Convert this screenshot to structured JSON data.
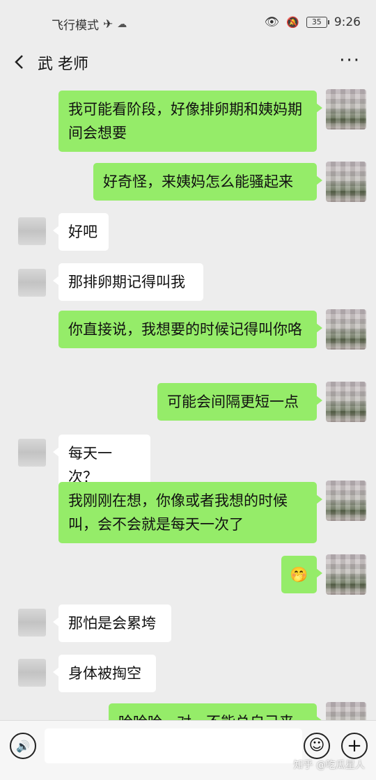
{
  "status_bar": {
    "mode_text": "飞行模式",
    "battery": "35",
    "time": "9:26"
  },
  "nav": {
    "contact_name": "武 老师",
    "more": "···"
  },
  "messages": [
    {
      "side": "out",
      "text": "我可能看阶段，好像排卵期和姨妈期间会想要"
    },
    {
      "side": "out",
      "text": "好奇怪，来姨妈怎么能骚起来"
    },
    {
      "side": "in",
      "text": "好吧"
    },
    {
      "side": "in",
      "text": "那排卵期记得叫我"
    },
    {
      "side": "out",
      "text": "你直接说，我想要的时候记得叫你咯"
    },
    {
      "side": "out",
      "text": "可能会间隔更短一点"
    },
    {
      "side": "in",
      "text": "每天一次？"
    },
    {
      "side": "out",
      "text": "我刚刚在想，你像或者我想的时候叫，会不会就是每天一次了"
    },
    {
      "side": "out",
      "text": "🤭"
    },
    {
      "side": "in",
      "text": "那怕是会累垮"
    },
    {
      "side": "in",
      "text": "身体被掏空"
    },
    {
      "side": "out",
      "text": "哈哈哈，对，不能总自己来"
    }
  ],
  "input": {
    "voice_icon": "voice-icon",
    "emoji_icon": "emoji-icon",
    "plus_icon": "plus-icon"
  },
  "watermark": "知乎 @吃瓜星人"
}
